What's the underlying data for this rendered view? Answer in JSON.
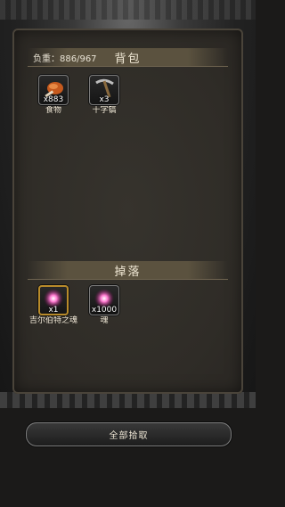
{
  "backpack": {
    "title": "背包",
    "load_label": "负重：886/967",
    "items": [
      {
        "icon": "food-icon",
        "count": "x883",
        "name": "食物"
      },
      {
        "icon": "pickaxe-icon",
        "count": "x3",
        "name": "十字镐"
      }
    ]
  },
  "drops": {
    "title": "掉落",
    "items": [
      {
        "icon": "soul-orb-icon",
        "count": "x1",
        "name": "吉尔伯特之魂"
      },
      {
        "icon": "soul-orb-icon",
        "count": "x1000",
        "name": "魂"
      }
    ]
  },
  "pickup_all_label": "全部拾取",
  "colors": {
    "gold_border": "#b88b2a",
    "soul_glow": "#ff4fb8"
  }
}
